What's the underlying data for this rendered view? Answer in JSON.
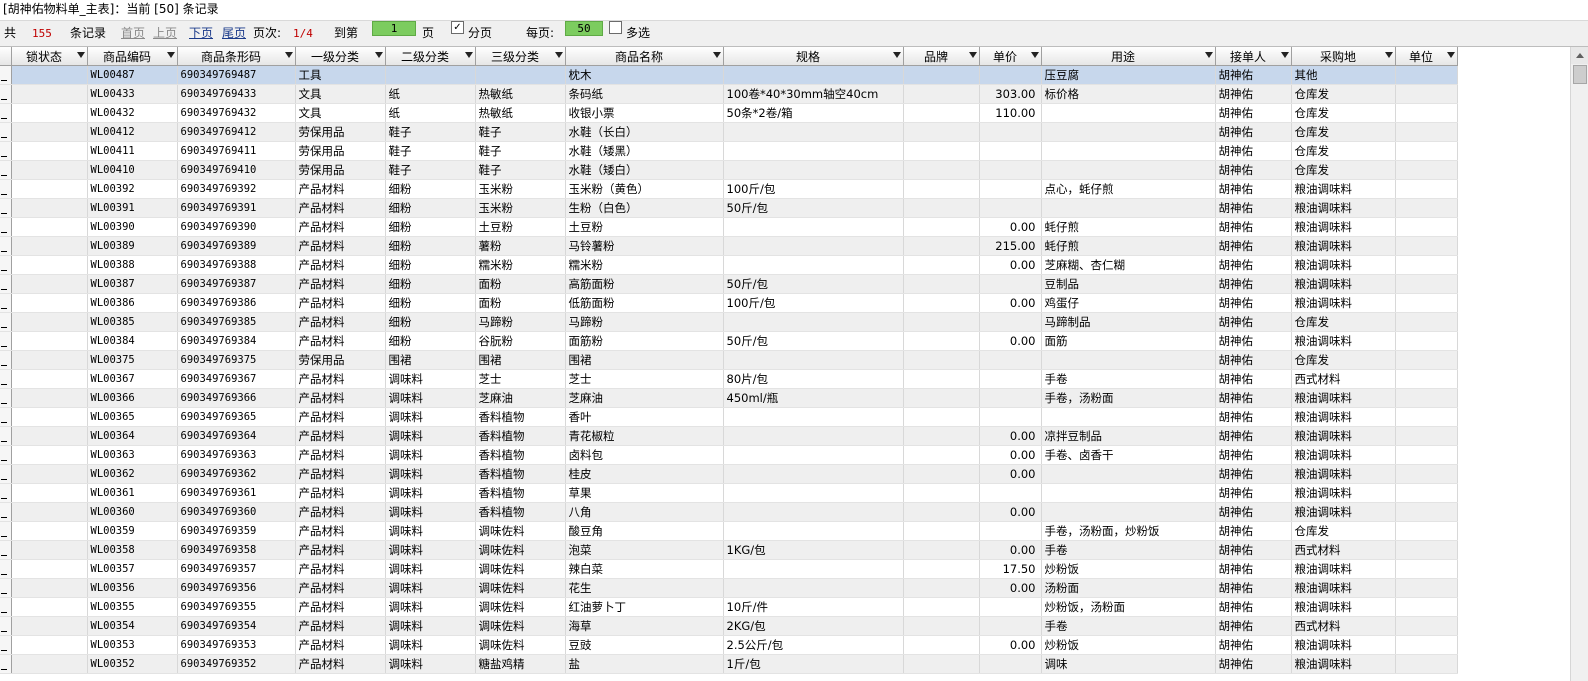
{
  "title": "[胡神佑物料单_主表]：当前 [50] 条记录",
  "pager": {
    "total_prefix": "共",
    "total": "155",
    "total_suffix": "条记录",
    "first": "首页",
    "prev": "上页",
    "next": "下页",
    "last": "尾页",
    "page_label": "页次:",
    "page_value": "1/4",
    "goto_label": "到第",
    "goto_value": "1",
    "page_unit": "页",
    "paginate_label": "分页",
    "paginate_checked": "✓",
    "per_page_label": "每页:",
    "per_page_value": "50",
    "multiselect_label": "多选"
  },
  "columns": [
    "锁状态",
    "商品编码",
    "商品条形码",
    "一级分类",
    "二级分类",
    "三级分类",
    "商品名称",
    "规格",
    "品牌",
    "单价",
    "用途",
    "接单人",
    "采购地",
    "单位"
  ],
  "rows": [
    [
      "",
      "WL00487",
      "690349769487",
      "工具",
      "",
      "",
      "枕木",
      "",
      "",
      "",
      "压豆腐",
      "胡神佑",
      "其他",
      ""
    ],
    [
      "",
      "WL00433",
      "690349769433",
      "文具",
      "纸",
      "热敏纸",
      "条码纸",
      "100卷*40*30mm轴空40cm",
      "",
      "303.00",
      "标价格",
      "胡神佑",
      "仓库发",
      ""
    ],
    [
      "",
      "WL00432",
      "690349769432",
      "文具",
      "纸",
      "热敏纸",
      "收银小票",
      "50条*2卷/箱",
      "",
      "110.00",
      "",
      "胡神佑",
      "仓库发",
      ""
    ],
    [
      "",
      "WL00412",
      "690349769412",
      "劳保用品",
      "鞋子",
      "鞋子",
      "水鞋（长白）",
      "",
      "",
      "",
      "",
      "胡神佑",
      "仓库发",
      ""
    ],
    [
      "",
      "WL00411",
      "690349769411",
      "劳保用品",
      "鞋子",
      "鞋子",
      "水鞋（矮黑）",
      "",
      "",
      "",
      "",
      "胡神佑",
      "仓库发",
      ""
    ],
    [
      "",
      "WL00410",
      "690349769410",
      "劳保用品",
      "鞋子",
      "鞋子",
      "水鞋（矮白）",
      "",
      "",
      "",
      "",
      "胡神佑",
      "仓库发",
      ""
    ],
    [
      "",
      "WL00392",
      "690349769392",
      "产品材料",
      "细粉",
      "玉米粉",
      "玉米粉（黄色）",
      "100斤/包",
      "",
      "",
      "点心，蚝仔煎",
      "胡神佑",
      "粮油调味料",
      ""
    ],
    [
      "",
      "WL00391",
      "690349769391",
      "产品材料",
      "细粉",
      "玉米粉",
      "生粉（白色）",
      "50斤/包",
      "",
      "",
      "",
      "胡神佑",
      "粮油调味料",
      ""
    ],
    [
      "",
      "WL00390",
      "690349769390",
      "产品材料",
      "细粉",
      "土豆粉",
      "土豆粉",
      "",
      "",
      "0.00",
      "蚝仔煎",
      "胡神佑",
      "粮油调味料",
      ""
    ],
    [
      "",
      "WL00389",
      "690349769389",
      "产品材料",
      "细粉",
      "薯粉",
      "马铃薯粉",
      "",
      "",
      "215.00",
      "蚝仔煎",
      "胡神佑",
      "粮油调味料",
      ""
    ],
    [
      "",
      "WL00388",
      "690349769388",
      "产品材料",
      "细粉",
      "糯米粉",
      "糯米粉",
      "",
      "",
      "0.00",
      "芝麻糊、杏仁糊",
      "胡神佑",
      "粮油调味料",
      ""
    ],
    [
      "",
      "WL00387",
      "690349769387",
      "产品材料",
      "细粉",
      "面粉",
      "高筋面粉",
      "50斤/包",
      "",
      "",
      "豆制品",
      "胡神佑",
      "粮油调味料",
      ""
    ],
    [
      "",
      "WL00386",
      "690349769386",
      "产品材料",
      "细粉",
      "面粉",
      "低筋面粉",
      "100斤/包",
      "",
      "0.00",
      "鸡蛋仔",
      "胡神佑",
      "粮油调味料",
      ""
    ],
    [
      "",
      "WL00385",
      "690349769385",
      "产品材料",
      "细粉",
      "马蹄粉",
      "马蹄粉",
      "",
      "",
      "",
      "马蹄制品",
      "胡神佑",
      "仓库发",
      ""
    ],
    [
      "",
      "WL00384",
      "690349769384",
      "产品材料",
      "细粉",
      "谷朊粉",
      "面筋粉",
      "50斤/包",
      "",
      "0.00",
      "面筋",
      "胡神佑",
      "粮油调味料",
      ""
    ],
    [
      "",
      "WL00375",
      "690349769375",
      "劳保用品",
      "围裙",
      "围裙",
      "围裙",
      "",
      "",
      "",
      "",
      "胡神佑",
      "仓库发",
      ""
    ],
    [
      "",
      "WL00367",
      "690349769367",
      "产品材料",
      "调味料",
      "芝士",
      "芝士",
      "80片/包",
      "",
      "",
      "手卷",
      "胡神佑",
      "西式材料",
      ""
    ],
    [
      "",
      "WL00366",
      "690349769366",
      "产品材料",
      "调味料",
      "芝麻油",
      "芝麻油",
      "450ml/瓶",
      "",
      "",
      "手卷，汤粉面",
      "胡神佑",
      "粮油调味料",
      ""
    ],
    [
      "",
      "WL00365",
      "690349769365",
      "产品材料",
      "调味料",
      "香料植物",
      "香叶",
      "",
      "",
      "",
      "",
      "胡神佑",
      "粮油调味料",
      ""
    ],
    [
      "",
      "WL00364",
      "690349769364",
      "产品材料",
      "调味料",
      "香料植物",
      "青花椒粒",
      "",
      "",
      "0.00",
      "凉拌豆制品",
      "胡神佑",
      "粮油调味料",
      ""
    ],
    [
      "",
      "WL00363",
      "690349769363",
      "产品材料",
      "调味料",
      "香料植物",
      "卤料包",
      "",
      "",
      "0.00",
      "手卷、卤香干",
      "胡神佑",
      "粮油调味料",
      ""
    ],
    [
      "",
      "WL00362",
      "690349769362",
      "产品材料",
      "调味料",
      "香料植物",
      "桂皮",
      "",
      "",
      "0.00",
      "",
      "胡神佑",
      "粮油调味料",
      ""
    ],
    [
      "",
      "WL00361",
      "690349769361",
      "产品材料",
      "调味料",
      "香料植物",
      "草果",
      "",
      "",
      "",
      "",
      "胡神佑",
      "粮油调味料",
      ""
    ],
    [
      "",
      "WL00360",
      "690349769360",
      "产品材料",
      "调味料",
      "香料植物",
      "八角",
      "",
      "",
      "0.00",
      "",
      "胡神佑",
      "粮油调味料",
      ""
    ],
    [
      "",
      "WL00359",
      "690349769359",
      "产品材料",
      "调味料",
      "调味佐料",
      "酸豆角",
      "",
      "",
      "",
      "手卷，汤粉面，炒粉饭",
      "胡神佑",
      "仓库发",
      ""
    ],
    [
      "",
      "WL00358",
      "690349769358",
      "产品材料",
      "调味料",
      "调味佐料",
      "泡菜",
      "1KG/包",
      "",
      "0.00",
      "手卷",
      "胡神佑",
      "西式材料",
      ""
    ],
    [
      "",
      "WL00357",
      "690349769357",
      "产品材料",
      "调味料",
      "调味佐料",
      "辣白菜",
      "",
      "",
      "17.50",
      "炒粉饭",
      "胡神佑",
      "粮油调味料",
      ""
    ],
    [
      "",
      "WL00356",
      "690349769356",
      "产品材料",
      "调味料",
      "调味佐料",
      "花生",
      "",
      "",
      "0.00",
      "汤粉面",
      "胡神佑",
      "粮油调味料",
      ""
    ],
    [
      "",
      "WL00355",
      "690349769355",
      "产品材料",
      "调味料",
      "调味佐料",
      "红油萝卜丁",
      "10斤/件",
      "",
      "",
      "炒粉饭，汤粉面",
      "胡神佑",
      "粮油调味料",
      ""
    ],
    [
      "",
      "WL00354",
      "690349769354",
      "产品材料",
      "调味料",
      "调味佐料",
      "海草",
      "2KG/包",
      "",
      "",
      "手卷",
      "胡神佑",
      "西式材料",
      ""
    ],
    [
      "",
      "WL00353",
      "690349769353",
      "产品材料",
      "调味料",
      "调味佐料",
      "豆豉",
      "2.5公斤/包",
      "",
      "0.00",
      "炒粉饭",
      "胡神佑",
      "粮油调味料",
      ""
    ],
    [
      "",
      "WL00352",
      "690349769352",
      "产品材料",
      "调味料",
      "糖盐鸡精",
      "盐",
      "1斤/包",
      "",
      "",
      "调味",
      "胡神佑",
      "粮油调味料",
      ""
    ]
  ]
}
